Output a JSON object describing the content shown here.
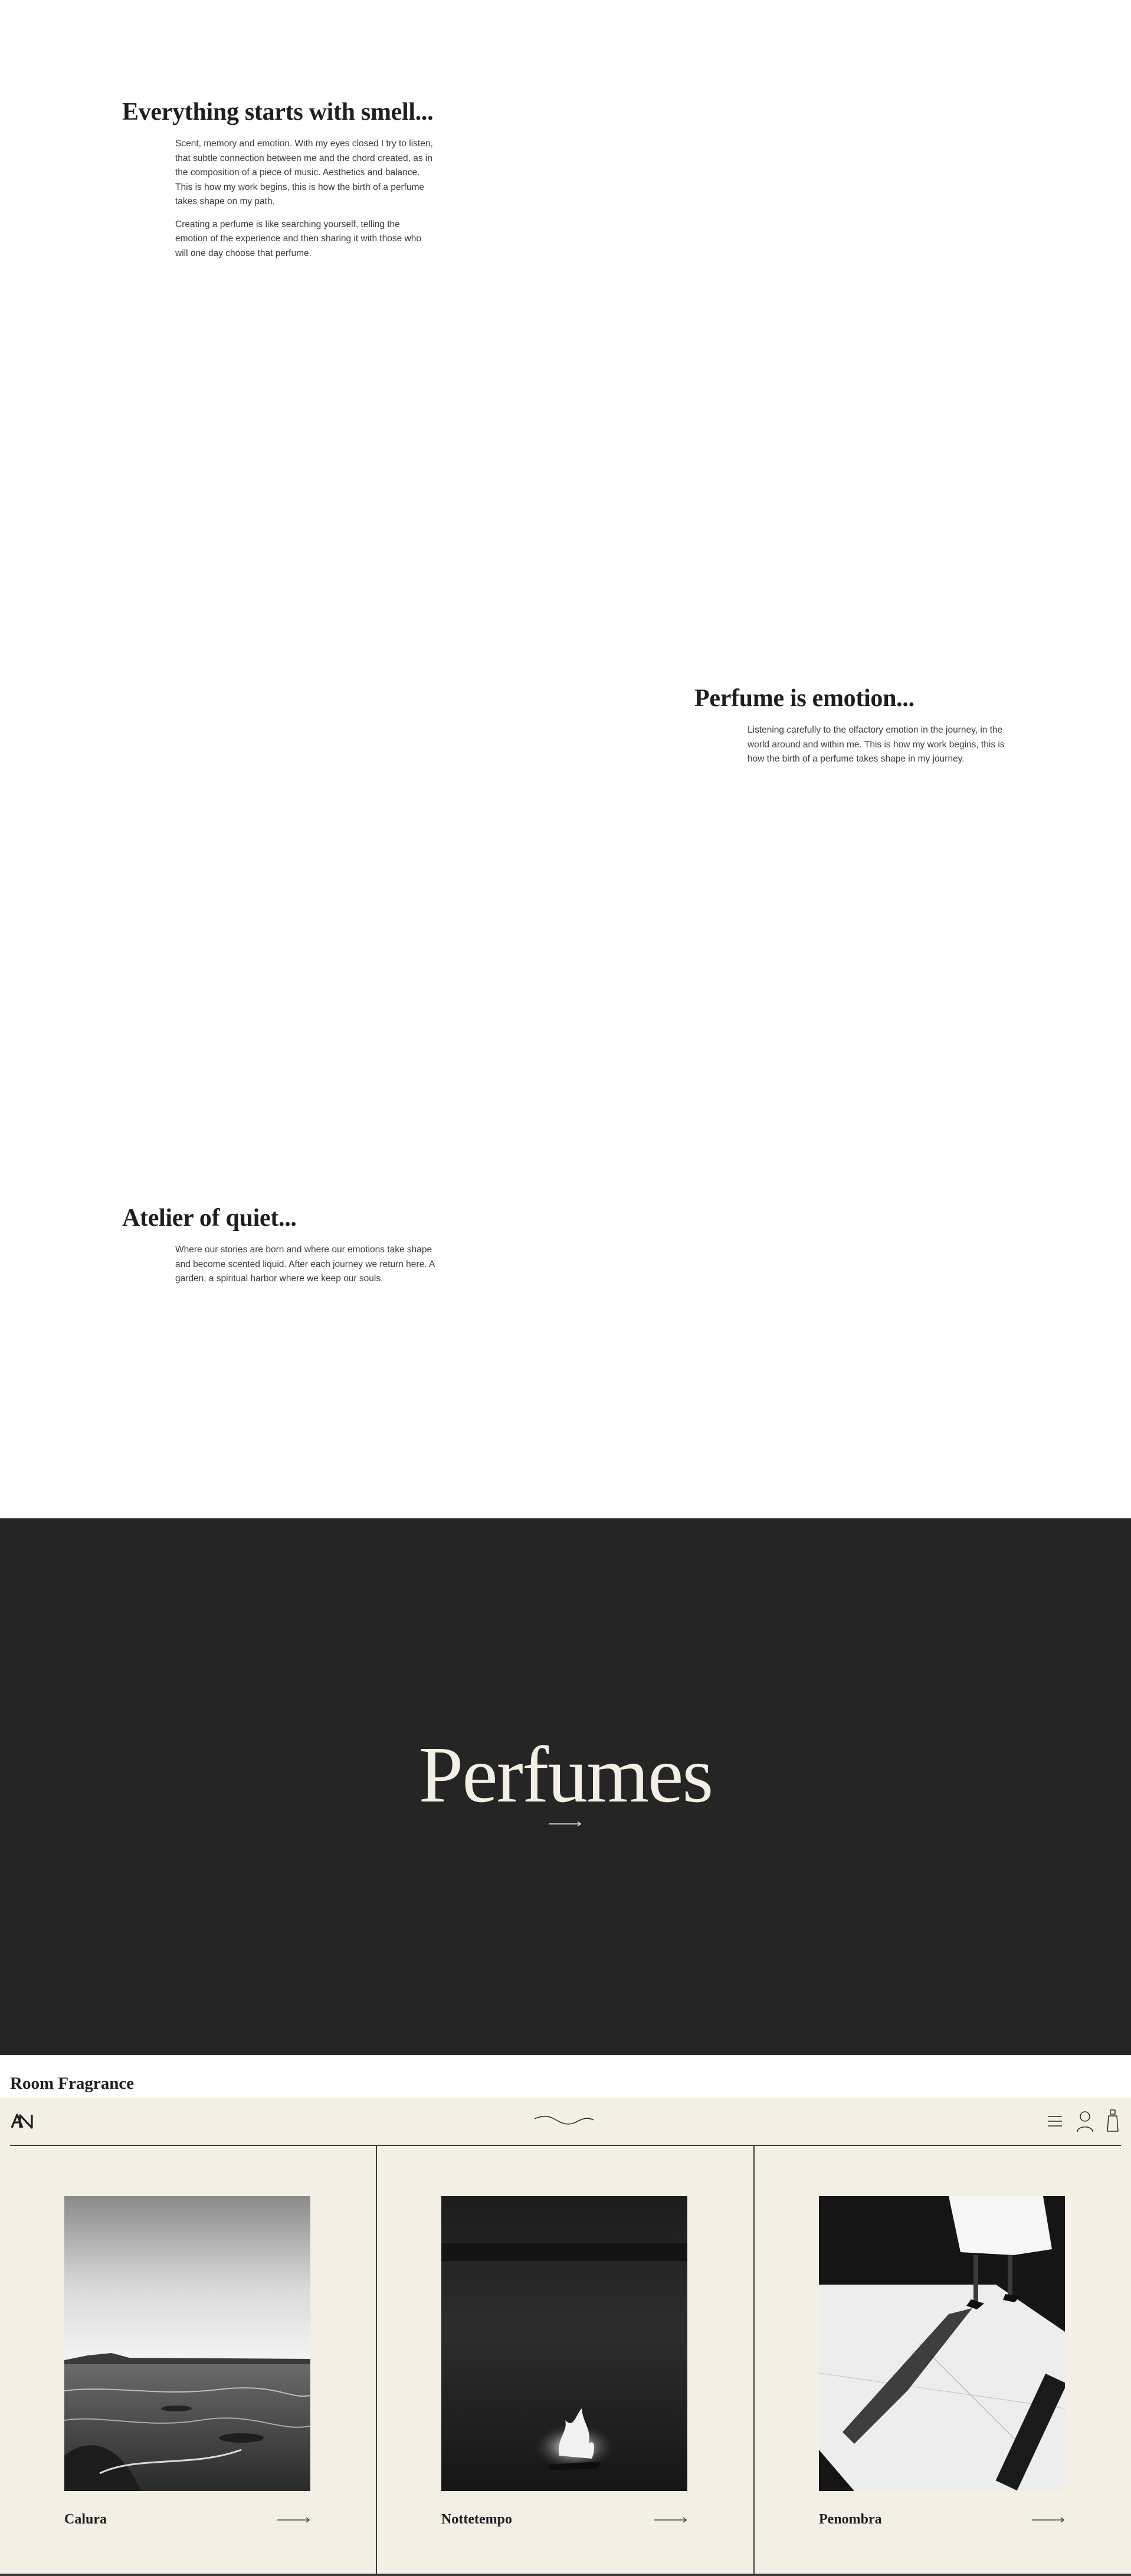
{
  "stories": [
    {
      "title": "Everything starts with smell...",
      "paragraphs": [
        "Scent, memory and emotion. With my eyes closed I try to listen, that subtle connection between me and the chord created, as in the composition of a piece of music. Aesthetics and balance. This is how my work begins, this is how the birth of a perfume takes shape on my path.",
        "Creating a perfume is like searching yourself, telling the emotion of the experience and then sharing it with those who will one day choose that perfume."
      ]
    },
    {
      "title": "Perfume is emotion...",
      "paragraphs": [
        "Listening carefully to the olfactory emotion in the journey, in the world around and within me. This is how my work begins, this is how the birth of a perfume takes shape in my journey."
      ]
    },
    {
      "title": "Atelier of quiet...",
      "paragraphs": [
        "Where our stories are born and where our emotions take shape and become scented liquid. After each journey we return here. A garden, a spiritual harbor where we keep our souls."
      ]
    }
  ],
  "perfumes_section": {
    "title": "Perfumes",
    "arrow_icon": "arrow-right-icon",
    "background": "#252525",
    "text_color": "#f3efe4"
  },
  "room_fragrance": {
    "label": "Room Fragrance"
  },
  "shop_header": {
    "logo_icon": "brand-monogram-icon",
    "center_icon": "wave-icon",
    "icons": [
      "menu-icon",
      "account-icon",
      "bag-icon"
    ],
    "background": "#f3efe4"
  },
  "products": [
    {
      "name": "Calura",
      "image": "seashore-photo",
      "arrow_icon": "arrow-right-icon"
    },
    {
      "name": "Nottetempo",
      "image": "night-fire-photo",
      "arrow_icon": "arrow-right-icon"
    },
    {
      "name": "Penombra",
      "image": "shadow-figure-photo",
      "arrow_icon": "arrow-right-icon"
    }
  ]
}
